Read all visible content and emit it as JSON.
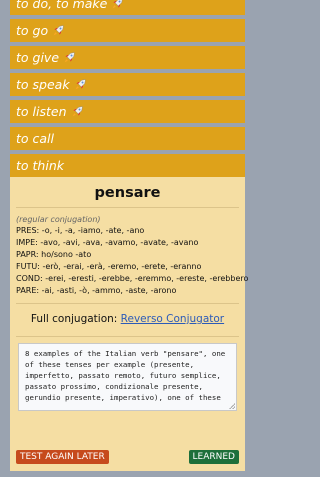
{
  "verbs": [
    {
      "label": "to do, to make",
      "rocket": true
    },
    {
      "label": "to go",
      "rocket": true
    },
    {
      "label": "to give",
      "rocket": true
    },
    {
      "label": "to speak",
      "rocket": true
    },
    {
      "label": "to listen",
      "rocket": true
    },
    {
      "label": "to call",
      "rocket": false
    },
    {
      "label": "to think",
      "rocket": false
    }
  ],
  "card": {
    "title": "pensare",
    "note": "(regular conjugation)",
    "conjugations": [
      "PRES: -o, -i, -a, -iamo, -ate, -ano",
      "IMPE: -avo, -avi, -ava, -avamo, -avate, -avano",
      "PAPR: ho/sono -ato",
      "FUTU: -erò, -erai, -erà, -eremo, -erete, -eranno",
      "COND: -erei, -eresti, -erebbe, -eremmo, -ereste, -erebbero",
      "PARE: -ai, -asti, -ò, -ammo, -aste, -arono"
    ],
    "full_conj_label": "Full conjugation:",
    "full_conj_link": "Reverso Conjugator",
    "examples_text": "8 examples of the Italian verb \"pensare\", one of these tenses per example (presente, imperfetto, passato remoto, futuro semplice, passato prossimo, condizionale presente, gerundio presente, imperativo), one of these",
    "test_again_label": "TEST AGAIN LATER",
    "learned_label": "LEARNED"
  },
  "colors": {
    "item_bg": "#dea21a",
    "card_bg": "#f5dea3",
    "page_bg": "#9aa3b0",
    "link": "#2c5bb8",
    "test_again_bg": "#c64a1c",
    "learned_bg": "#1d6f3a"
  },
  "icons": {
    "rocket": "rocket-icon"
  }
}
